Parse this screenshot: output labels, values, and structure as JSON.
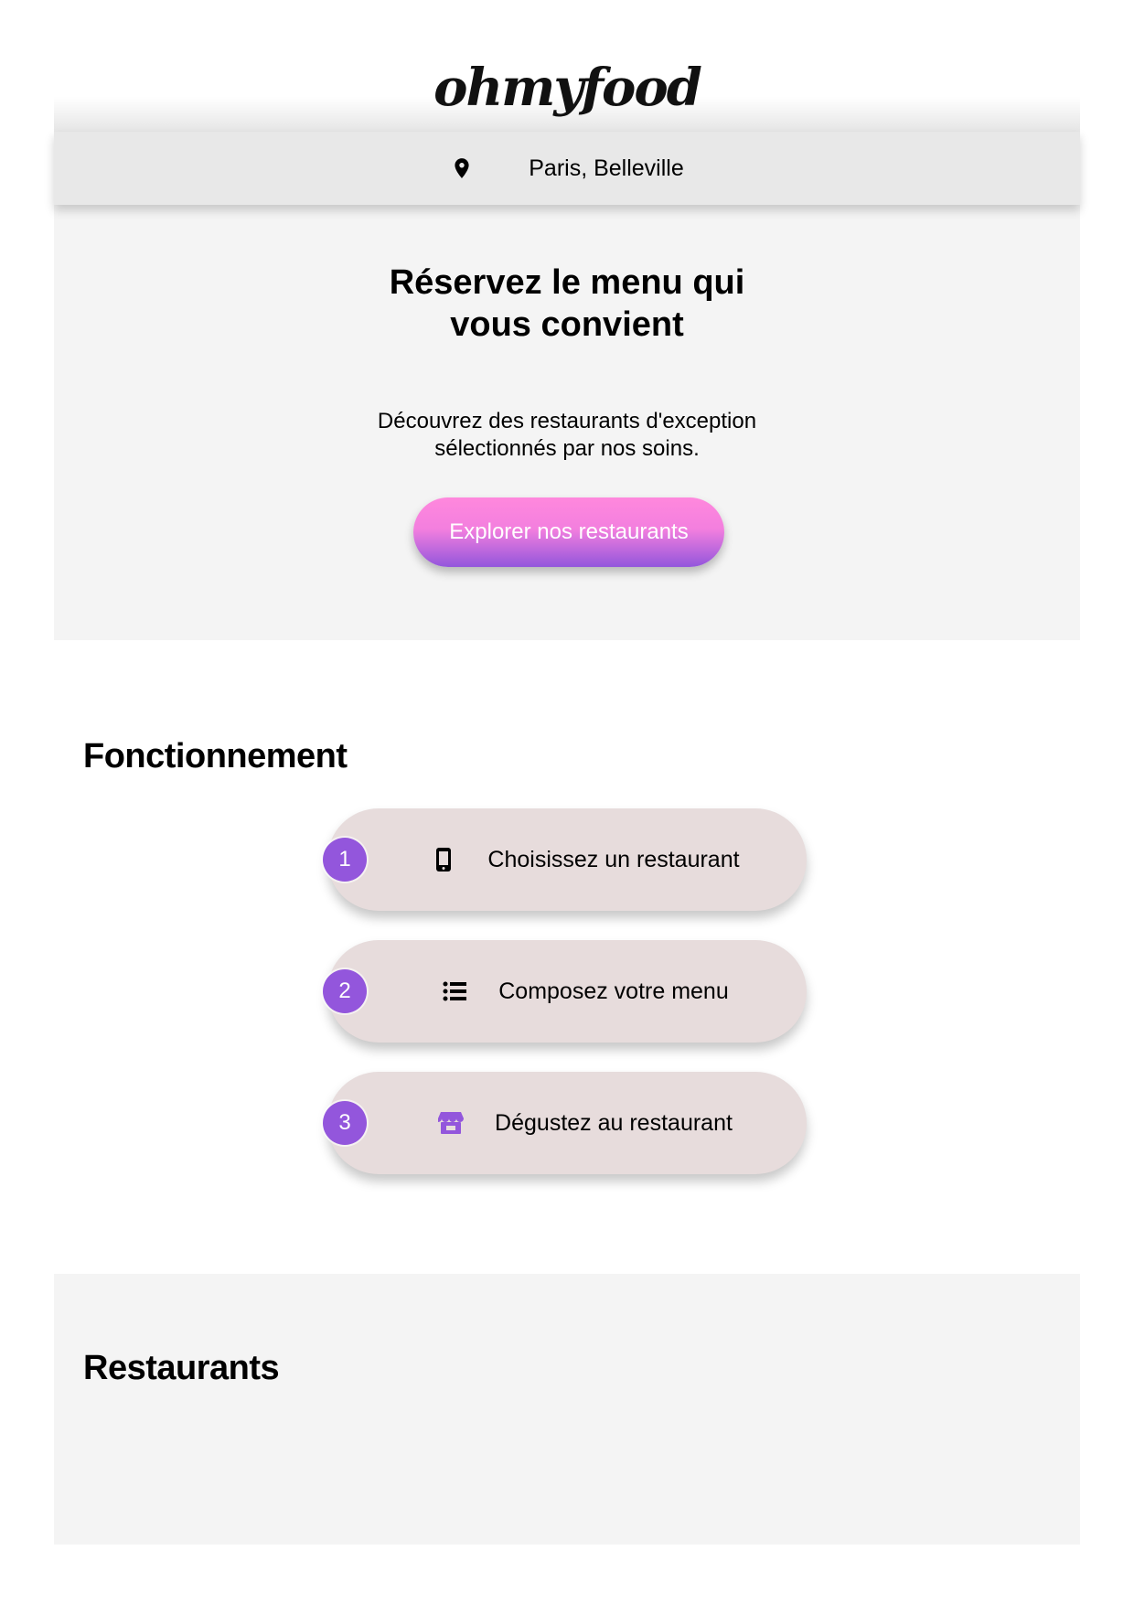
{
  "header": {
    "logo": "ohmyfood",
    "location": "Paris, Belleville",
    "location_icon": "map-pin-icon"
  },
  "hero": {
    "title": "Réservez le menu qui vous convient",
    "subtitle": "Découvrez des restaurants d'exception sélectionnés par nos soins.",
    "button_label": "Explorer nos restaurants"
  },
  "how_it_works": {
    "title": "Fonctionnement",
    "steps": [
      {
        "number": "1",
        "icon": "smartphone-icon",
        "label": "Choisissez un restaurant"
      },
      {
        "number": "2",
        "icon": "list-icon",
        "label": "Composez votre menu"
      },
      {
        "number": "3",
        "icon": "store-icon",
        "label": "Dégustez au restaurant"
      }
    ]
  },
  "restaurants": {
    "title": "Restaurants"
  },
  "colors": {
    "accent_purple": "#9356dc",
    "accent_pink": "#ff79da",
    "step_bg": "#e7dcdc",
    "section_bg": "#f4f4f4",
    "location_bg": "#e8e8e8"
  }
}
